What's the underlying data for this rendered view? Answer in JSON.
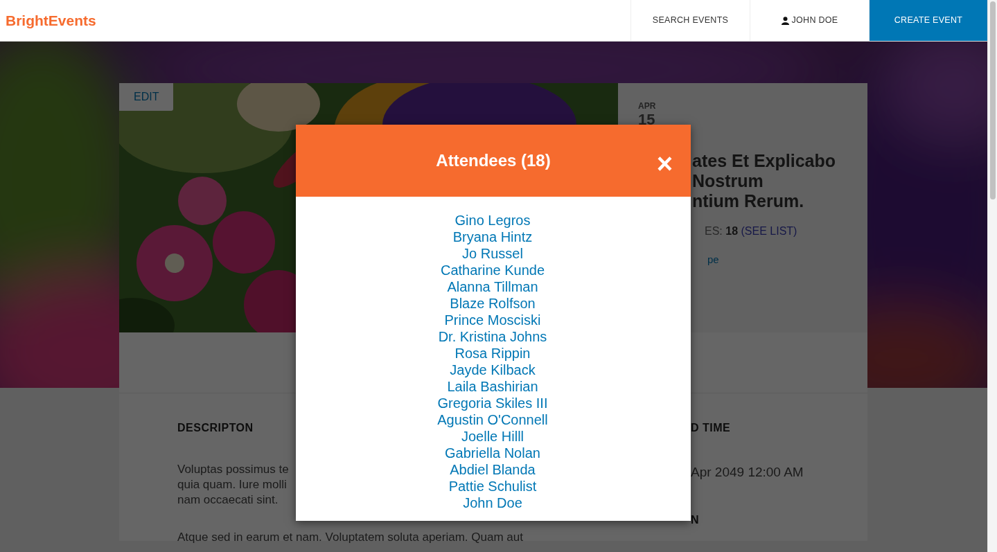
{
  "navbar": {
    "brand": "BrightEvents",
    "links": [
      {
        "label": "SEARCH EVENTS",
        "kind": "plain"
      },
      {
        "label": "JOHN DOE",
        "kind": "user"
      },
      {
        "label": "CREATE EVENT",
        "kind": "primary"
      }
    ]
  },
  "event": {
    "edit_button": "EDIT",
    "month": "APR",
    "day": "15",
    "title_lines": [
      "ates Et Explicabo",
      "Nostrum",
      "ntium Rerum."
    ],
    "attendees_label": "ES:",
    "attendees_count": "18",
    "see_list": "(SEE LIST)",
    "organizer": "pe"
  },
  "description": {
    "heading": "DESCRIPTON",
    "lines": [
      "Voluptas possimus te",
      "quia quam. Iure molli",
      "nam occaecati sint."
    ],
    "paragraph_2": "Atque sed in earum et nam. Voluptatem soluta aperiam. Quam aut"
  },
  "details": {
    "time_heading": "D TIME",
    "time_value": "Apr 2049 12:00 AM",
    "location_heading": "N"
  },
  "modal": {
    "title": "Attendees (18)",
    "close": "×",
    "attendees": [
      "Gino Legros",
      "Bryana Hintz",
      "Jo Russel",
      "Catharine Kunde",
      "Alanna Tillman",
      "Blaze Rolfson",
      "Prince Mosciski",
      "Dr. Kristina Johns",
      "Rosa Rippin",
      "Jayde Kilback",
      "Laila Bashirian",
      "Gregoria Skiles III",
      "Agustin O'Connell",
      "Joelle Hilll",
      "Gabriella Nolan",
      "Abdiel Blanda",
      "Pattie Schulist",
      "John Doe"
    ]
  }
}
